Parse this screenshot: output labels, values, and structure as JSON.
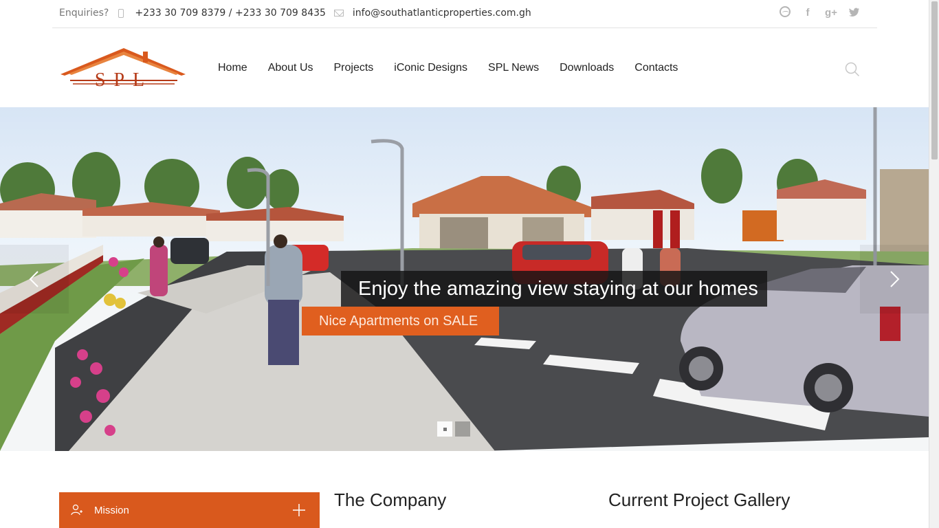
{
  "topbar": {
    "enquiries_label": "Enquiries?",
    "phones": "+233 30 709 8379 / +233 30 709 8435",
    "email": "info@southatlanticproperties.com.gh",
    "social": [
      {
        "name": "dribbble-icon",
        "glyph": ""
      },
      {
        "name": "facebook-icon",
        "glyph": "f"
      },
      {
        "name": "google-plus-icon",
        "glyph": "g+"
      },
      {
        "name": "twitter-icon",
        "glyph": "t"
      }
    ]
  },
  "logo": {
    "text": "SPL",
    "color": "#b53a17"
  },
  "nav": {
    "items": [
      "Home",
      "About Us",
      "Projects",
      "iConic Designs",
      "SPL News",
      "Downloads",
      "Contacts"
    ]
  },
  "hero": {
    "caption_main": "Enjoy the amazing view staying at our homes",
    "caption_sub": "Nice Apartments on SALE",
    "slide_count": 2,
    "active_slide": 1
  },
  "content": {
    "mission_label": "Mission",
    "company_title": "The Company",
    "gallery_title": "Current Project Gallery"
  },
  "colors": {
    "accent": "#d9591d",
    "caption_bg": "#141414"
  }
}
